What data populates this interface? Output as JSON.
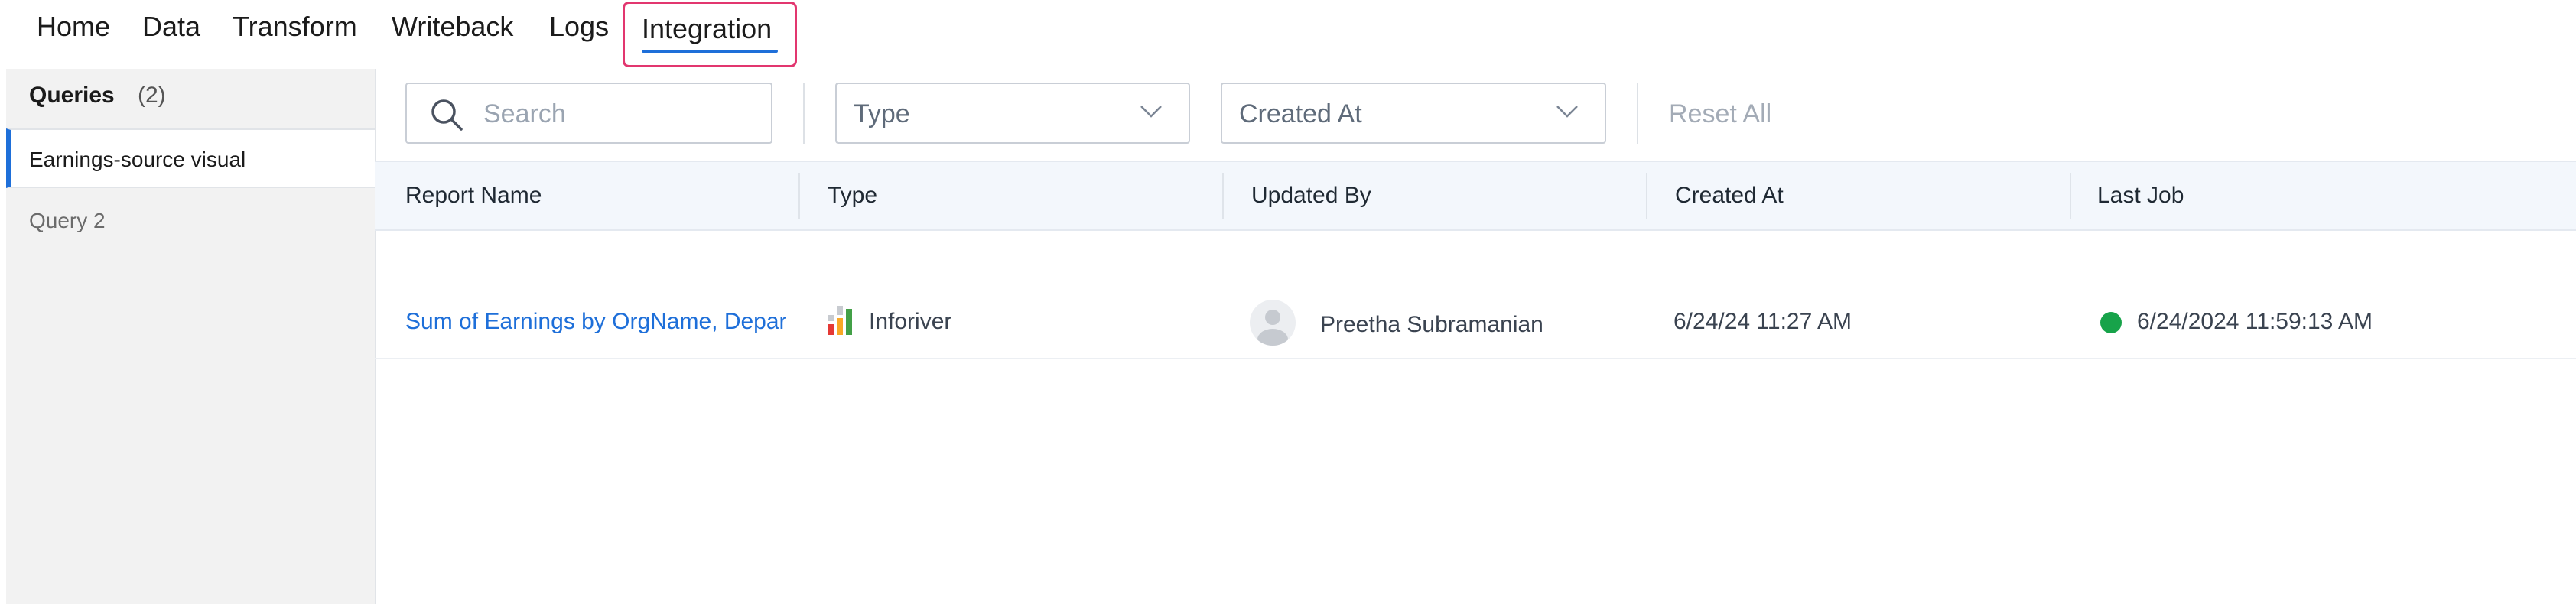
{
  "nav": {
    "home": "Home",
    "data": "Data",
    "transform": "Transform",
    "writeback": "Writeback",
    "logs": "Logs",
    "integration": "Integration",
    "active": "Integration",
    "accent_color": "#1e6fd9",
    "highlight_color": "#e2366f"
  },
  "sidebar": {
    "title": "Queries",
    "count": "(2)",
    "items": [
      {
        "label": "Earnings-source visual",
        "active": true
      },
      {
        "label": "Query 2",
        "active": false
      }
    ]
  },
  "filters": {
    "search_placeholder": "Search",
    "type_label": "Type",
    "created_at_label": "Created At",
    "reset_label": "Reset All"
  },
  "table": {
    "headers": [
      "Report Name",
      "Type",
      "Updated By",
      "Created At",
      "Last Job"
    ],
    "rows": [
      {
        "report_name": "Sum of Earnings by OrgName, Depar",
        "type": "Inforiver",
        "updated_by": "Preetha Subramanian",
        "created_at": "6/24/24 11:27 AM",
        "last_job": "6/24/2024 11:59:13 AM",
        "status_color": "#17a34a"
      }
    ]
  }
}
